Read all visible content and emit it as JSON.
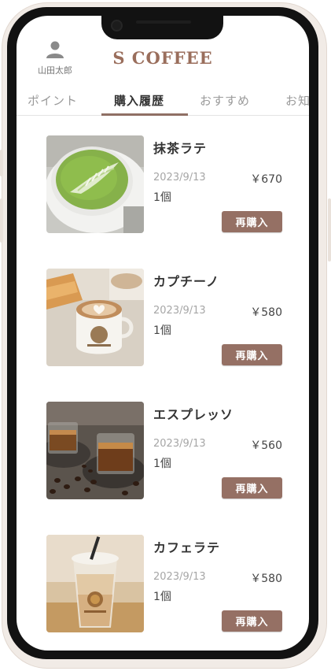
{
  "header": {
    "brand": "S COFFEE",
    "user_name": "山田太郎"
  },
  "tabs": [
    {
      "label": "ポイント",
      "active": false
    },
    {
      "label": "購入履歴",
      "active": true
    },
    {
      "label": "おすすめ",
      "active": false
    },
    {
      "label": "お知",
      "active": false
    }
  ],
  "purchases": [
    {
      "name": "抹茶ラテ",
      "date": "2023/9/13",
      "price": "￥670",
      "qty": "1個",
      "button": "再購入"
    },
    {
      "name": "カプチーノ",
      "date": "2023/9/13",
      "price": "￥580",
      "qty": "1個",
      "button": "再購入"
    },
    {
      "name": "エスプレッソ",
      "date": "2023/9/13",
      "price": "￥560",
      "qty": "1個",
      "button": "再購入"
    },
    {
      "name": "カフェラテ",
      "date": "2023/9/13",
      "price": "￥580",
      "qty": "1個",
      "button": "再購入"
    }
  ],
  "colors": {
    "accent": "#957064",
    "brand_text": "#9a6e5c",
    "phone_frame": "#121212"
  }
}
